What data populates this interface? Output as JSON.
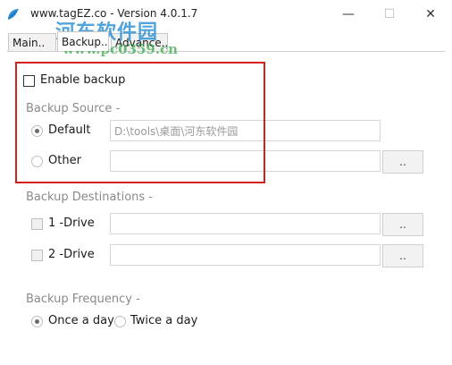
{
  "window": {
    "title": "www.tagEZ.co - Version 4.0.1.7",
    "minimize_glyph": "—",
    "maximize_glyph": "☐",
    "close_glyph": "✕"
  },
  "watermark": {
    "line1": "河东软件园",
    "line2": "www.pc0359.cn"
  },
  "tabs": [
    {
      "label": "Main..",
      "active": false
    },
    {
      "label": "Backup..",
      "active": true
    },
    {
      "label": "Advance..",
      "active": false
    }
  ],
  "backup": {
    "enable_label": "Enable backup",
    "source": {
      "heading": "Backup Source -",
      "default_label": "Default",
      "default_value": "D:\\tools\\桌面\\河东软件园",
      "other_label": "Other",
      "other_value": "",
      "browse_label": ".."
    },
    "destinations": {
      "heading": "Backup Destinations -",
      "drive1_label": "1 -Drive",
      "drive1_value": "",
      "drive2_label": "2 -Drive",
      "drive2_value": "",
      "browse1_label": "..",
      "browse2_label": ".."
    },
    "frequency": {
      "heading": "Backup Frequency -",
      "once_label": "Once a day",
      "twice_label": "Twice a day"
    }
  },
  "colors": {
    "highlight_border": "#d42020",
    "watermark_blue": "#288cd2",
    "watermark_green": "#3caa50"
  },
  "icons": {
    "app_icon": "app-logo-icon"
  }
}
